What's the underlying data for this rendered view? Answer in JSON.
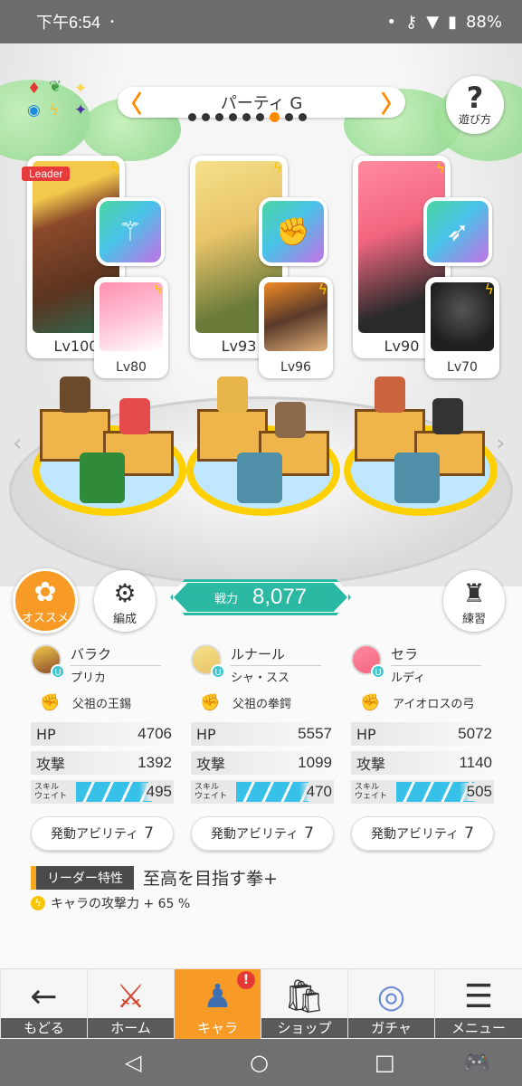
{
  "status_bar": {
    "time": "下午6:54",
    "dot": "•",
    "battery": "88%"
  },
  "party": {
    "name": "パーティ G",
    "prev_arrow": "〈",
    "next_arrow": "〉",
    "page_count": 9,
    "active_page": 7
  },
  "help": {
    "icon": "?",
    "label": "遊び方"
  },
  "leader_tag": "Leader",
  "cards": [
    {
      "main_level": "Lv100",
      "sub_level": "Lv80"
    },
    {
      "main_level": "Lv93",
      "sub_level": "Lv96"
    },
    {
      "main_level": "Lv90",
      "sub_level": "Lv70"
    }
  ],
  "controls": {
    "recommend_label": "オススメ",
    "formation_label": "編成",
    "practice_label": "練習",
    "power_label": "戦力",
    "power_value": "8,077"
  },
  "members": [
    {
      "name": "バラク",
      "sub": "プリカ",
      "weapon": "父祖の王錫",
      "hp_label": "HP",
      "hp": "4706",
      "atk_label": "攻撃",
      "atk": "1392",
      "wait_label": "スキル\nウェイト",
      "wait": "495",
      "wait_fill": 0.78,
      "ability_label": "発動アビリティ",
      "ability_count": "7"
    },
    {
      "name": "ルナール",
      "sub": "シャ・スス",
      "weapon": "父祖の拳鍔",
      "hp_label": "HP",
      "hp": "5557",
      "atk_label": "攻撃",
      "atk": "1099",
      "wait_label": "スキル\nウェイト",
      "wait": "470",
      "wait_fill": 0.74,
      "ability_label": "発動アビリティ",
      "ability_count": "7"
    },
    {
      "name": "セラ",
      "sub": "ルディ",
      "weapon": "アイオロスの弓",
      "hp_label": "HP",
      "hp": "5072",
      "atk_label": "攻撃",
      "atk": "1140",
      "wait_label": "スキル\nウェイト",
      "wait": "505",
      "wait_fill": 0.8,
      "ability_label": "発動アビリティ",
      "ability_count": "7"
    }
  ],
  "leader": {
    "tag": "リーダー特性",
    "skill": "至高を目指す拳+",
    "effect": "キャラの攻撃力 + 65 %"
  },
  "nav": [
    {
      "label": "もどる",
      "icon": "←"
    },
    {
      "label": "ホーム",
      "icon": "⚔"
    },
    {
      "label": "キャラ",
      "icon": "♟",
      "badge": "!"
    },
    {
      "label": "ショップ",
      "icon": "🛍"
    },
    {
      "label": "ガチャ",
      "icon": "◎"
    },
    {
      "label": "メニュー",
      "icon": "☰"
    }
  ],
  "system_nav": {
    "back": "◁",
    "home": "○",
    "recent": "□",
    "game": "🎮"
  },
  "colors": {
    "accent": "#f89a26",
    "power": "#2cb9a3",
    "wait_bar": "#37c0e8",
    "weapon_grad": "#49c2e8"
  }
}
